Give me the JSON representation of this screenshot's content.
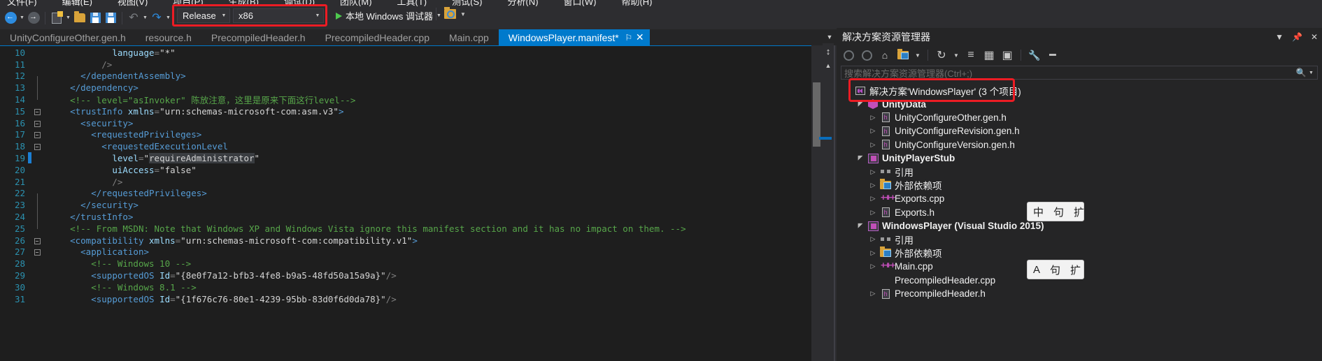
{
  "window": {
    "menu_items": [
      "文件(F)",
      "编辑(E)",
      "视图(V)",
      "项目(P)",
      "生成(B)",
      "调试(D)",
      "团队(M)",
      "工具(T)",
      "测试(S)",
      "分析(N)",
      "窗口(W)",
      "帮助(H)"
    ]
  },
  "toolbar": {
    "back_icon": "navigate-back-icon",
    "forward_icon": "navigate-forward-icon",
    "new_item_icon": "new-item-icon",
    "open_file_icon": "open-file-icon",
    "save_icon": "save-icon",
    "save_all_icon": "save-all-icon",
    "undo_icon": "undo-icon",
    "redo_icon": "redo-icon",
    "configuration": "Release",
    "platform": "x86",
    "run_label": "本地 Windows 调试器",
    "find_icon": "find-in-files-icon"
  },
  "tabs": [
    {
      "label": "UnityConfigureOther.gen.h",
      "active": false
    },
    {
      "label": "resource.h",
      "active": false
    },
    {
      "label": "PrecompiledHeader.h",
      "active": false
    },
    {
      "label": "PrecompiledHeader.cpp",
      "active": false
    },
    {
      "label": "Main.cpp",
      "active": false
    },
    {
      "label": "WindowsPlayer.manifest*",
      "active": true
    }
  ],
  "tab_overflow_icon": "chevron-down-icon",
  "editor": {
    "lines": [
      {
        "num": "10",
        "fold": "",
        "changed": false,
        "tokens": [
          {
            "t": "            ",
            "c": "plain"
          },
          {
            "t": "language",
            "c": "attr"
          },
          {
            "t": "=",
            "c": "punct"
          },
          {
            "t": "\"*\"",
            "c": "val"
          }
        ]
      },
      {
        "num": "11",
        "fold": "",
        "changed": false,
        "tokens": [
          {
            "t": "          ",
            "c": "plain"
          },
          {
            "t": "/>",
            "c": "punct"
          }
        ]
      },
      {
        "num": "12",
        "fold": "end",
        "changed": false,
        "tokens": [
          {
            "t": "      ",
            "c": "plain"
          },
          {
            "t": "</dependentAssembly>",
            "c": "tag"
          }
        ]
      },
      {
        "num": "13",
        "fold": "end",
        "changed": false,
        "tokens": [
          {
            "t": "    ",
            "c": "plain"
          },
          {
            "t": "</dependency>",
            "c": "tag"
          }
        ]
      },
      {
        "num": "14",
        "fold": "",
        "changed": false,
        "tokens": [
          {
            "t": "    ",
            "c": "plain"
          },
          {
            "t": "<!-- level=\"asInvoker\" 陈放注意，这里是原来下面这行level-->",
            "c": "cmt"
          }
        ]
      },
      {
        "num": "15",
        "fold": "box",
        "changed": false,
        "tokens": [
          {
            "t": "    ",
            "c": "plain"
          },
          {
            "t": "<trustInfo ",
            "c": "tag"
          },
          {
            "t": "xmlns",
            "c": "attr"
          },
          {
            "t": "=",
            "c": "punct"
          },
          {
            "t": "\"urn:schemas-microsoft-com:asm.v3\"",
            "c": "val"
          },
          {
            "t": ">",
            "c": "tag"
          }
        ]
      },
      {
        "num": "16",
        "fold": "box",
        "changed": false,
        "tokens": [
          {
            "t": "      ",
            "c": "plain"
          },
          {
            "t": "<security>",
            "c": "tag"
          }
        ]
      },
      {
        "num": "17",
        "fold": "box",
        "changed": false,
        "tokens": [
          {
            "t": "        ",
            "c": "plain"
          },
          {
            "t": "<requestedPrivileges>",
            "c": "tag"
          }
        ]
      },
      {
        "num": "18",
        "fold": "box",
        "changed": false,
        "tokens": [
          {
            "t": "          ",
            "c": "plain"
          },
          {
            "t": "<requestedExecutionLevel",
            "c": "tag"
          }
        ]
      },
      {
        "num": "19",
        "fold": "",
        "changed": true,
        "tokens": [
          {
            "t": "            ",
            "c": "plain"
          },
          {
            "t": "level",
            "c": "attr"
          },
          {
            "t": "=",
            "c": "punct"
          },
          {
            "t": "\"",
            "c": "val"
          },
          {
            "t": "requireAdministrator",
            "c": "sel"
          },
          {
            "t": "\"",
            "c": "val"
          }
        ]
      },
      {
        "num": "20",
        "fold": "",
        "changed": false,
        "tokens": [
          {
            "t": "            ",
            "c": "plain"
          },
          {
            "t": "uiAccess",
            "c": "attr"
          },
          {
            "t": "=",
            "c": "punct"
          },
          {
            "t": "\"false\"",
            "c": "val"
          }
        ]
      },
      {
        "num": "21",
        "fold": "",
        "changed": false,
        "tokens": [
          {
            "t": "            ",
            "c": "plain"
          },
          {
            "t": "/>",
            "c": "punct"
          }
        ]
      },
      {
        "num": "22",
        "fold": "end",
        "changed": false,
        "tokens": [
          {
            "t": "        ",
            "c": "plain"
          },
          {
            "t": "</requestedPrivileges>",
            "c": "tag"
          }
        ]
      },
      {
        "num": "23",
        "fold": "end",
        "changed": false,
        "tokens": [
          {
            "t": "      ",
            "c": "plain"
          },
          {
            "t": "</security>",
            "c": "tag"
          }
        ]
      },
      {
        "num": "24",
        "fold": "end",
        "changed": false,
        "tokens": [
          {
            "t": "    ",
            "c": "plain"
          },
          {
            "t": "</trustInfo>",
            "c": "tag"
          }
        ]
      },
      {
        "num": "25",
        "fold": "",
        "changed": false,
        "tokens": [
          {
            "t": "    ",
            "c": "plain"
          },
          {
            "t": "<!-- From MSDN: Note that Windows XP and Windows Vista ignore this manifest section and it has no impact on them. -->",
            "c": "cmt"
          }
        ]
      },
      {
        "num": "26",
        "fold": "box",
        "changed": false,
        "tokens": [
          {
            "t": "    ",
            "c": "plain"
          },
          {
            "t": "<compatibility ",
            "c": "tag"
          },
          {
            "t": "xmlns",
            "c": "attr"
          },
          {
            "t": "=",
            "c": "punct"
          },
          {
            "t": "\"urn:schemas-microsoft-com:compatibility.v1\"",
            "c": "val"
          },
          {
            "t": ">",
            "c": "tag"
          }
        ]
      },
      {
        "num": "27",
        "fold": "box",
        "changed": false,
        "tokens": [
          {
            "t": "      ",
            "c": "plain"
          },
          {
            "t": "<application>",
            "c": "tag"
          }
        ]
      },
      {
        "num": "28",
        "fold": "",
        "changed": false,
        "tokens": [
          {
            "t": "        ",
            "c": "plain"
          },
          {
            "t": "<!-- Windows 10 -->",
            "c": "cmt"
          }
        ]
      },
      {
        "num": "29",
        "fold": "",
        "changed": false,
        "tokens": [
          {
            "t": "        ",
            "c": "plain"
          },
          {
            "t": "<supportedOS ",
            "c": "tag"
          },
          {
            "t": "Id",
            "c": "attr"
          },
          {
            "t": "=",
            "c": "punct"
          },
          {
            "t": "\"{8e0f7a12-bfb3-4fe8-b9a5-48fd50a15a9a}\"",
            "c": "val"
          },
          {
            "t": "/>",
            "c": "punct"
          }
        ]
      },
      {
        "num": "30",
        "fold": "",
        "changed": false,
        "tokens": [
          {
            "t": "        ",
            "c": "plain"
          },
          {
            "t": "<!-- Windows 8.1 -->",
            "c": "cmt"
          }
        ]
      },
      {
        "num": "31",
        "fold": "",
        "changed": false,
        "tokens": [
          {
            "t": "        ",
            "c": "plain"
          },
          {
            "t": "<supportedOS ",
            "c": "tag"
          },
          {
            "t": "Id",
            "c": "attr"
          },
          {
            "t": "=",
            "c": "punct"
          },
          {
            "t": "\"{1f676c76-80e1-4239-95bb-83d0f6d0da78}\"",
            "c": "val"
          },
          {
            "t": "/>",
            "c": "punct"
          }
        ]
      }
    ]
  },
  "solution_explorer": {
    "title": "解决方案资源管理器",
    "pin_icon": "pin-icon",
    "close_icon": "close-icon",
    "dropdown_icon": "chevron-down-icon",
    "toolbar_icons": [
      "back-icon",
      "forward-icon",
      "home-icon",
      "sync-with-active-document-icon",
      "chevron-down-icon",
      "refresh-icon",
      "collapse-all-icon",
      "show-all-files-icon",
      "properties-icon",
      "preview-selected-items-icon",
      "properties-window-icon"
    ],
    "search_placeholder": "搜索解决方案资源管理器(Ctrl+;)",
    "search_icon": "search-icon",
    "search_caret_icon": "chevron-down-icon",
    "tree": [
      {
        "indent": 0,
        "twisty": "none",
        "icon": "solution-icon",
        "label": "解决方案'WindowsPlayer' (3 个项目)",
        "bold": false
      },
      {
        "indent": 1,
        "twisty": "open",
        "icon": "unity-project-icon",
        "label": "UnityData",
        "bold": true
      },
      {
        "indent": 2,
        "twisty": "closed",
        "icon": "header-file-icon",
        "label": "UnityConfigureOther.gen.h",
        "bold": false
      },
      {
        "indent": 2,
        "twisty": "closed",
        "icon": "header-file-icon",
        "label": "UnityConfigureRevision.gen.h",
        "bold": false
      },
      {
        "indent": 2,
        "twisty": "closed",
        "icon": "header-file-icon",
        "label": "UnityConfigureVersion.gen.h",
        "bold": false
      },
      {
        "indent": 1,
        "twisty": "open",
        "icon": "cpp-project-icon",
        "label": "UnityPlayerStub",
        "bold": true
      },
      {
        "indent": 2,
        "twisty": "closed",
        "icon": "references-icon",
        "label": "引用",
        "bold": false
      },
      {
        "indent": 2,
        "twisty": "closed",
        "icon": "external-dependencies-icon",
        "label": "外部依赖项",
        "bold": false
      },
      {
        "indent": 2,
        "twisty": "closed",
        "icon": "cpp-file-icon",
        "label": "Exports.cpp",
        "bold": false
      },
      {
        "indent": 2,
        "twisty": "closed",
        "icon": "header-file-icon",
        "label": "Exports.h",
        "bold": false
      },
      {
        "indent": 1,
        "twisty": "open",
        "icon": "cpp-project-icon",
        "label": "WindowsPlayer (Visual Studio 2015)",
        "bold": true
      },
      {
        "indent": 2,
        "twisty": "closed",
        "icon": "references-icon",
        "label": "引用",
        "bold": false
      },
      {
        "indent": 2,
        "twisty": "closed",
        "icon": "external-dependencies-icon",
        "label": "外部依赖项",
        "bold": false
      },
      {
        "indent": 2,
        "twisty": "closed",
        "icon": "cpp-file-icon",
        "label": "Main.cpp",
        "bold": false
      },
      {
        "indent": 2,
        "twisty": "none",
        "icon": "none",
        "label": "PrecompiledHeader.cpp",
        "bold": false
      },
      {
        "indent": 2,
        "twisty": "closed",
        "icon": "header-file-icon",
        "label": "PrecompiledHeader.h",
        "bold": false
      }
    ]
  },
  "ime_bars": [
    {
      "items": [
        "中",
        "句",
        "扩"
      ]
    },
    {
      "items": [
        "A",
        "句",
        "扩"
      ]
    }
  ],
  "colors": {
    "accent": "#007acc",
    "annotation_red": "#ec1c24",
    "editor_bg": "#1e1e1e",
    "chrome_bg": "#2d2d30",
    "panel_bg": "#252526",
    "comment_green": "#57a64a",
    "tag_blue": "#569cd6",
    "attr_blue": "#9cdcfe",
    "linenum_blue": "#2b91af"
  }
}
